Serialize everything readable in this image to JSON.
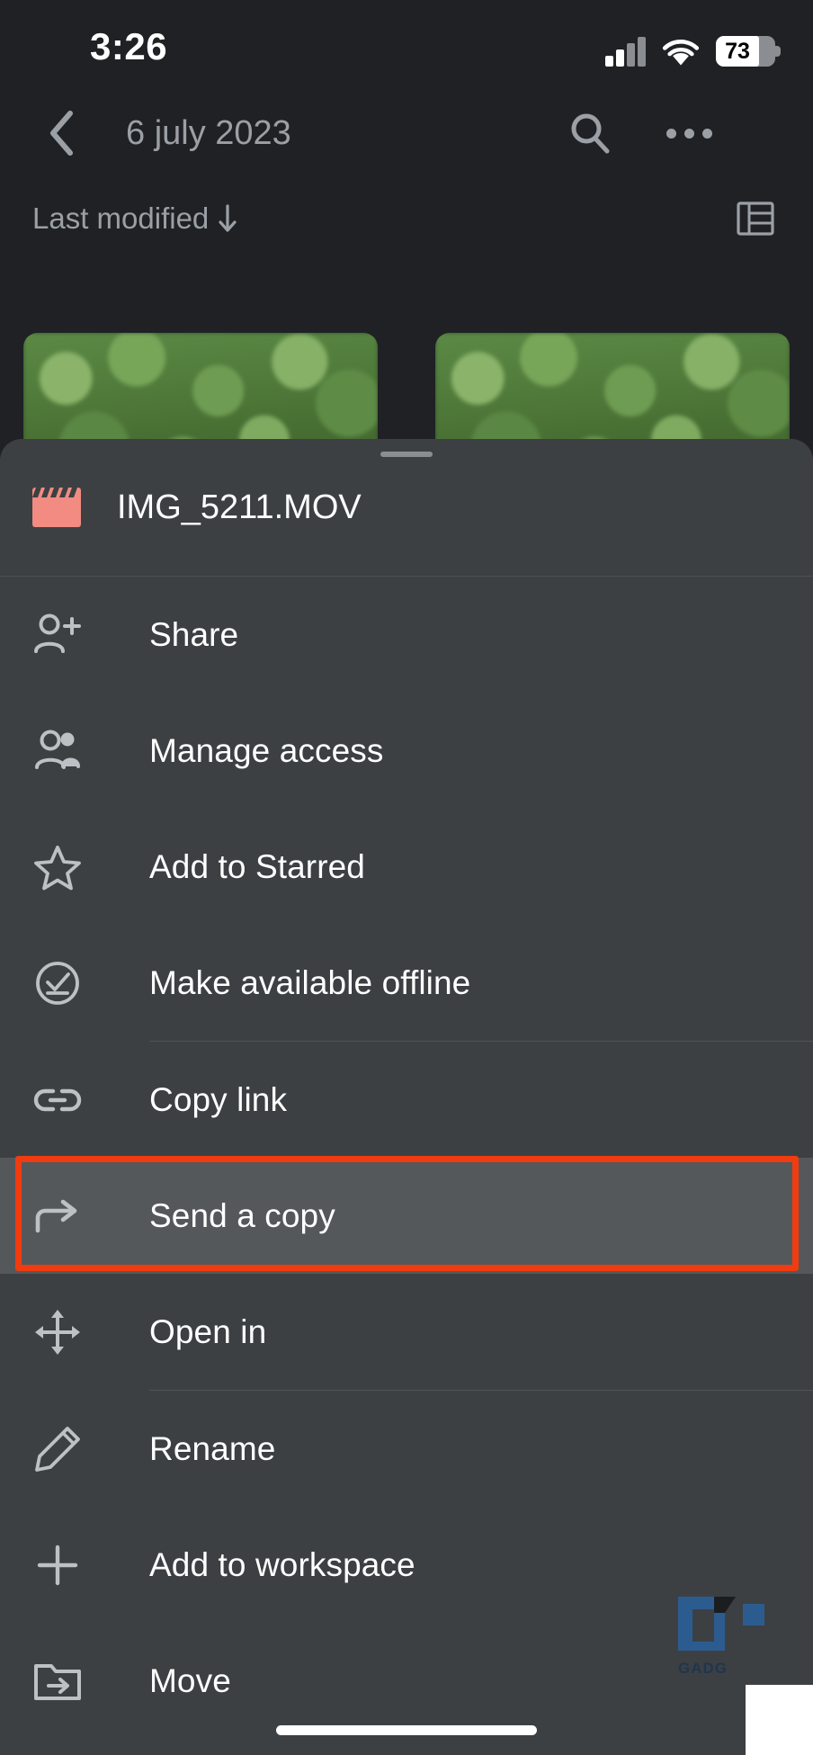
{
  "status_bar": {
    "time": "3:26",
    "battery_percent": "73",
    "signal_bars_filled": 2,
    "signal_bars_total": 4,
    "wifi_icon": "wifi-icon",
    "battery_icon": "battery-icon"
  },
  "app_bar": {
    "back_icon": "chevron-left-icon",
    "title": "6 july 2023",
    "search_icon": "search-icon",
    "more_icon": "more-horizontal-icon"
  },
  "sort_row": {
    "label": "Last modified",
    "sort_arrow_icon": "arrow-down-icon",
    "view_toggle_icon": "list-view-icon"
  },
  "sheet": {
    "drag_handle": "drag-handle",
    "file_icon": "video-clapperboard-icon",
    "file_name": "IMG_5211.MOV"
  },
  "menu": {
    "items": [
      {
        "label": "Share",
        "icon": "person-add-icon",
        "highlighted": false,
        "divider_after": false
      },
      {
        "label": "Manage access",
        "icon": "people-icon",
        "highlighted": false,
        "divider_after": false
      },
      {
        "label": "Add to Starred",
        "icon": "star-outline-icon",
        "highlighted": false,
        "divider_after": false
      },
      {
        "label": "Make available offline",
        "icon": "offline-check-icon",
        "highlighted": false,
        "divider_after": true
      },
      {
        "label": "Copy link",
        "icon": "link-icon",
        "highlighted": false,
        "divider_after": false
      },
      {
        "label": "Send a copy",
        "icon": "forward-arrow-icon",
        "highlighted": true,
        "divider_after": false
      },
      {
        "label": "Open in",
        "icon": "open-in-move-icon",
        "highlighted": false,
        "divider_after": true
      },
      {
        "label": "Rename",
        "icon": "pencil-icon",
        "highlighted": false,
        "divider_after": false
      },
      {
        "label": "Add to workspace",
        "icon": "plus-icon",
        "highlighted": false,
        "divider_after": false
      },
      {
        "label": "Move",
        "icon": "folder-move-icon",
        "highlighted": false,
        "divider_after": false
      }
    ]
  },
  "annotation": {
    "target_label": "Send a copy",
    "color": "#f03c10"
  },
  "watermark": {
    "text": "GADG"
  },
  "colors": {
    "screen_background": "#202124",
    "sheet_background": "#3c4043",
    "highlight_background": "#55585b",
    "primary_text": "#ffffff",
    "secondary_text": "#9aa0a6",
    "icon_color": "#bdc1c6",
    "video_icon": "#f28b82",
    "annotation_red": "#f03c10"
  }
}
